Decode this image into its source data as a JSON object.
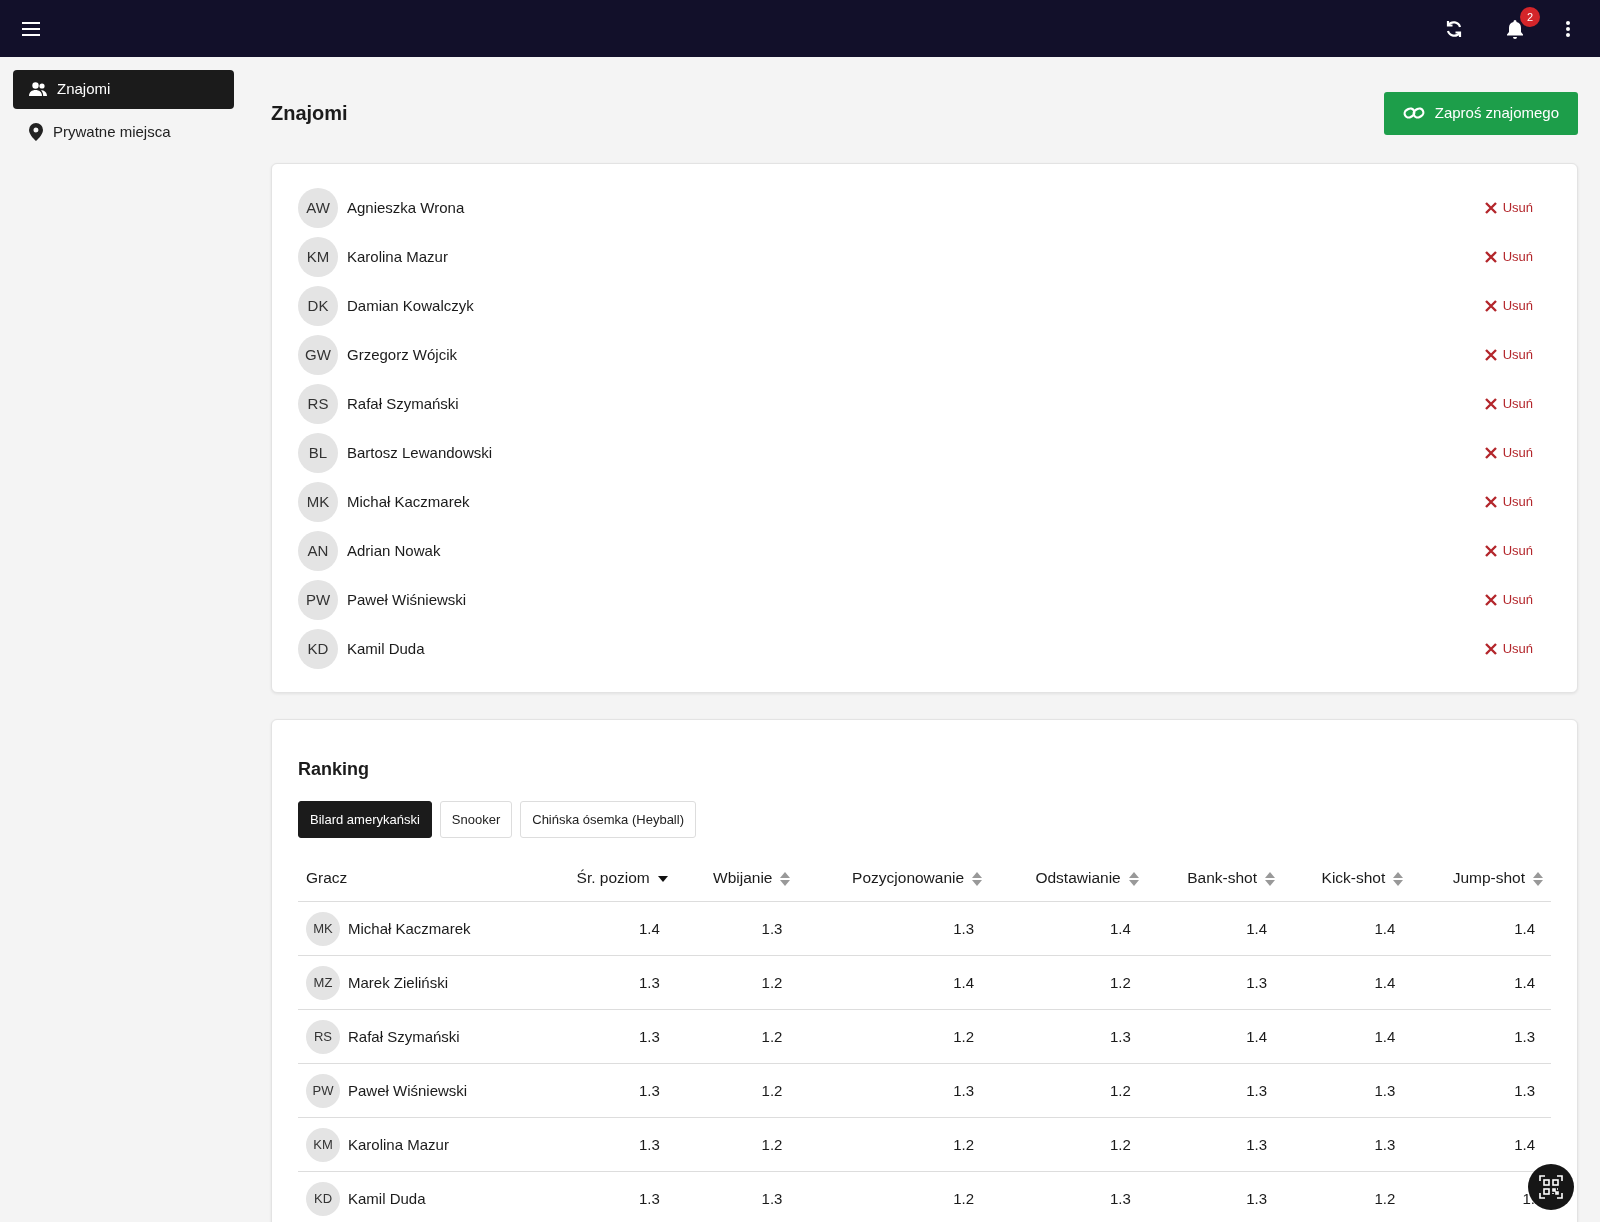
{
  "topbar": {
    "notifications": "2"
  },
  "sidebar": {
    "items": [
      {
        "label": "Znajomi",
        "selected": true
      },
      {
        "label": "Prywatne miejsca",
        "selected": false
      }
    ]
  },
  "page": {
    "title": "Znajomi",
    "invite_button": "Zaproś znajomego"
  },
  "friends": {
    "items": [
      {
        "initials": "AW",
        "name": "Agnieszka Wrona",
        "remove": "Usuń"
      },
      {
        "initials": "KM",
        "name": "Karolina Mazur",
        "remove": "Usuń"
      },
      {
        "initials": "DK",
        "name": "Damian Kowalczyk",
        "remove": "Usuń"
      },
      {
        "initials": "GW",
        "name": "Grzegorz Wójcik",
        "remove": "Usuń"
      },
      {
        "initials": "RS",
        "name": "Rafał Szymański",
        "remove": "Usuń"
      },
      {
        "initials": "BL",
        "name": "Bartosz Lewandowski",
        "remove": "Usuń"
      },
      {
        "initials": "MK",
        "name": "Michał Kaczmarek",
        "remove": "Usuń"
      },
      {
        "initials": "AN",
        "name": "Adrian Nowak",
        "remove": "Usuń"
      },
      {
        "initials": "PW",
        "name": "Paweł Wiśniewski",
        "remove": "Usuń"
      },
      {
        "initials": "KD",
        "name": "Kamil Duda",
        "remove": "Usuń"
      }
    ]
  },
  "ranking": {
    "title": "Ranking",
    "tabs": [
      {
        "label": "Bilard amerykański",
        "selected": true
      },
      {
        "label": "Snooker",
        "selected": false
      },
      {
        "label": "Chińska ósemka (Heyball)",
        "selected": false
      }
    ],
    "columns": [
      {
        "label": "Gracz",
        "sortable": false,
        "sorted": false
      },
      {
        "label": "Śr. poziom",
        "sortable": true,
        "sorted": true
      },
      {
        "label": "Wbijanie",
        "sortable": true,
        "sorted": false
      },
      {
        "label": "Pozycjonowanie",
        "sortable": true,
        "sorted": false
      },
      {
        "label": "Odstawianie",
        "sortable": true,
        "sorted": false
      },
      {
        "label": "Bank-shot",
        "sortable": true,
        "sorted": false
      },
      {
        "label": "Kick-shot",
        "sortable": true,
        "sorted": false
      },
      {
        "label": "Jump-shot",
        "sortable": true,
        "sorted": false
      }
    ],
    "rows": [
      {
        "initials": "MK",
        "name": "Michał Kaczmarek",
        "values": [
          "1.4",
          "1.3",
          "1.3",
          "1.4",
          "1.4",
          "1.4",
          "1.4"
        ]
      },
      {
        "initials": "MZ",
        "name": "Marek Zieliński",
        "values": [
          "1.3",
          "1.2",
          "1.4",
          "1.2",
          "1.3",
          "1.4",
          "1.4"
        ]
      },
      {
        "initials": "RS",
        "name": "Rafał Szymański",
        "values": [
          "1.3",
          "1.2",
          "1.2",
          "1.3",
          "1.4",
          "1.4",
          "1.3"
        ]
      },
      {
        "initials": "PW",
        "name": "Paweł Wiśniewski",
        "values": [
          "1.3",
          "1.2",
          "1.3",
          "1.2",
          "1.3",
          "1.3",
          "1.3"
        ]
      },
      {
        "initials": "KM",
        "name": "Karolina Mazur",
        "values": [
          "1.3",
          "1.2",
          "1.2",
          "1.2",
          "1.3",
          "1.3",
          "1.4"
        ]
      },
      {
        "initials": "KD",
        "name": "Kamil Duda",
        "values": [
          "1.3",
          "1.3",
          "1.2",
          "1.3",
          "1.3",
          "1.2",
          "1."
        ]
      }
    ]
  }
}
